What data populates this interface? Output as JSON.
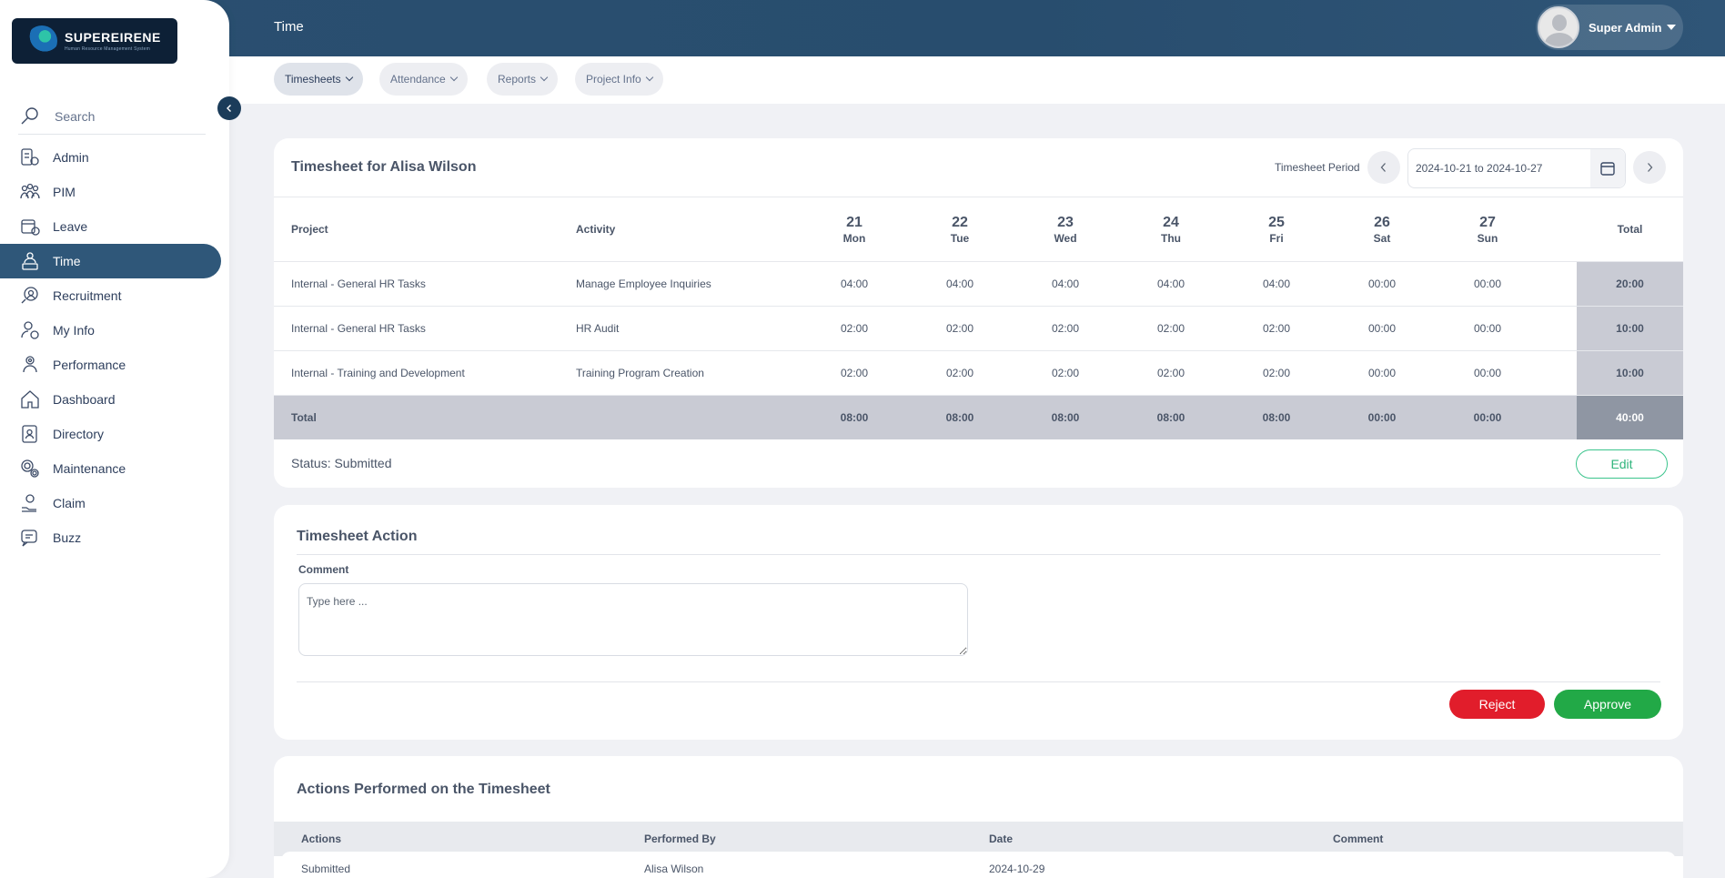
{
  "app": {
    "logo_name": "SUPEREIRENE",
    "logo_sub": "Human Resource Management System",
    "page_title": "Time",
    "user_name": "Super Admin"
  },
  "sidebar": {
    "search_label": "Search",
    "items": [
      {
        "label": "Admin",
        "icon": "admin-icon"
      },
      {
        "label": "PIM",
        "icon": "pim-icon"
      },
      {
        "label": "Leave",
        "icon": "leave-icon"
      },
      {
        "label": "Time",
        "icon": "time-icon",
        "active": true
      },
      {
        "label": "Recruitment",
        "icon": "recruitment-icon"
      },
      {
        "label": "My Info",
        "icon": "my-info-icon"
      },
      {
        "label": "Performance",
        "icon": "performance-icon"
      },
      {
        "label": "Dashboard",
        "icon": "dashboard-icon"
      },
      {
        "label": "Directory",
        "icon": "directory-icon"
      },
      {
        "label": "Maintenance",
        "icon": "maintenance-icon"
      },
      {
        "label": "Claim",
        "icon": "claim-icon"
      },
      {
        "label": "Buzz",
        "icon": "buzz-icon"
      }
    ]
  },
  "subnav": {
    "tabs": [
      {
        "label": "Timesheets",
        "active": true
      },
      {
        "label": "Attendance"
      },
      {
        "label": "Reports"
      },
      {
        "label": "Project Info"
      }
    ]
  },
  "timesheet": {
    "title": "Timesheet for Alisa Wilson",
    "period_label": "Timesheet Period",
    "period_value": "2024-10-21 to 2024-10-27",
    "headers": {
      "project": "Project",
      "activity": "Activity",
      "total": "Total"
    },
    "days": [
      {
        "date": "21",
        "weekday": "Mon"
      },
      {
        "date": "22",
        "weekday": "Tue"
      },
      {
        "date": "23",
        "weekday": "Wed"
      },
      {
        "date": "24",
        "weekday": "Thu"
      },
      {
        "date": "25",
        "weekday": "Fri"
      },
      {
        "date": "26",
        "weekday": "Sat"
      },
      {
        "date": "27",
        "weekday": "Sun"
      }
    ],
    "rows": [
      {
        "project": "Internal - General HR Tasks",
        "activity": "Manage Employee Inquiries",
        "hours": [
          "04:00",
          "04:00",
          "04:00",
          "04:00",
          "04:00",
          "00:00",
          "00:00"
        ],
        "total": "20:00"
      },
      {
        "project": "Internal - General HR Tasks",
        "activity": "HR Audit",
        "hours": [
          "02:00",
          "02:00",
          "02:00",
          "02:00",
          "02:00",
          "00:00",
          "00:00"
        ],
        "total": "10:00"
      },
      {
        "project": "Internal - Training and Development",
        "activity": "Training Program Creation",
        "hours": [
          "02:00",
          "02:00",
          "02:00",
          "02:00",
          "02:00",
          "00:00",
          "00:00"
        ],
        "total": "10:00"
      }
    ],
    "totals": {
      "label": "Total",
      "hours": [
        "08:00",
        "08:00",
        "08:00",
        "08:00",
        "08:00",
        "00:00",
        "00:00"
      ],
      "total": "40:00"
    },
    "status": "Status: Submitted",
    "edit_label": "Edit"
  },
  "action": {
    "title": "Timesheet Action",
    "comment_label": "Comment",
    "comment_placeholder": "Type here ...",
    "comment_value": "",
    "reject_label": "Reject",
    "approve_label": "Approve"
  },
  "history": {
    "title": "Actions Performed on the Timesheet",
    "headers": {
      "actions": "Actions",
      "performed_by": "Performed By",
      "date": "Date",
      "comment": "Comment"
    },
    "rows": [
      {
        "action": "Submitted",
        "performed_by": "Alisa Wilson",
        "date": "2024-10-29",
        "comment": ""
      }
    ]
  },
  "colors": {
    "topbar": "#2a4f70",
    "active_nav": "#2f5779",
    "approve": "#22a947",
    "reject": "#e11d2b",
    "edit_outline": "#3ac48c"
  }
}
